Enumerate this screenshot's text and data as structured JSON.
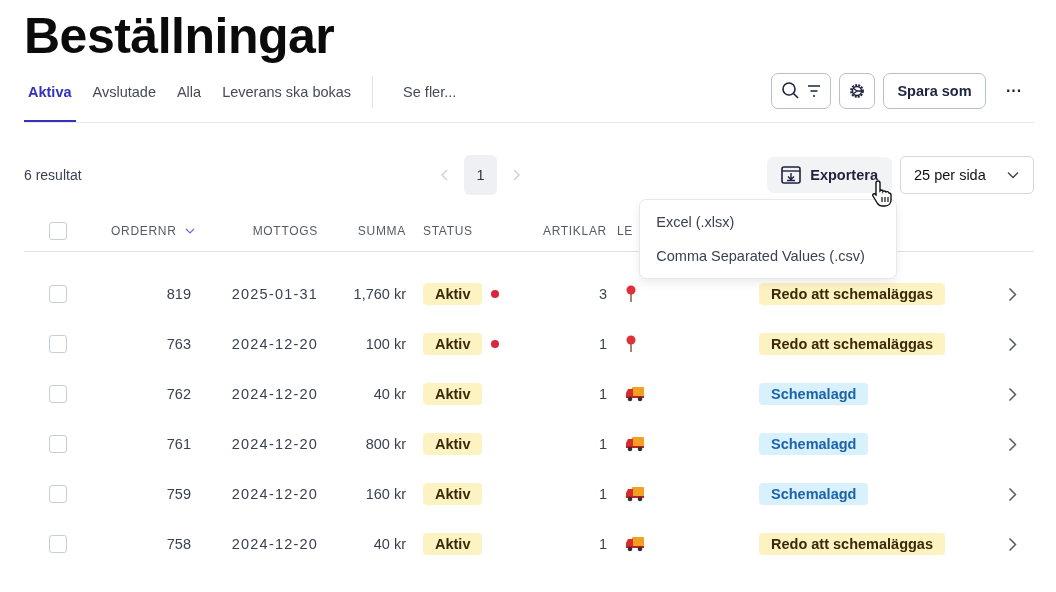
{
  "title": "Beställningar",
  "tabs": [
    {
      "label": "Aktiva",
      "selected": true
    },
    {
      "label": "Avslutade",
      "selected": false
    },
    {
      "label": "Alla",
      "selected": false
    },
    {
      "label": "Leverans ska bokas",
      "selected": false
    }
  ],
  "more_tabs": "Se fler...",
  "toolbar": {
    "save_as": "Spara som",
    "more": "···"
  },
  "results": "6 resultat",
  "pagination": {
    "pages": [
      {
        "label": "1",
        "selected": true
      }
    ]
  },
  "export": {
    "label": "Exportera",
    "menu": [
      "Excel (.xlsx)",
      "Comma Separated Values (.csv)"
    ]
  },
  "per_page": "25 per sida",
  "table": {
    "select_all_checked": false,
    "columns": [
      "ORDERNR",
      "MOTTOGS",
      "SUMMA",
      "STATUS",
      "ARTIKLAR",
      "LE"
    ],
    "rows": [
      {
        "checked": false,
        "order": "819",
        "received": "2025-01-31",
        "sum": "1,760 kr",
        "status": "Aktiv",
        "flagged": true,
        "items": "3",
        "delivery": {
          "kind": "pin"
        },
        "booking": {
          "label": "Redo att schemaläggas",
          "kind": "ready"
        }
      },
      {
        "checked": false,
        "order": "763",
        "received": "2024-12-20",
        "sum": "100 kr",
        "status": "Aktiv",
        "flagged": true,
        "items": "1",
        "delivery": {
          "kind": "pin"
        },
        "booking": {
          "label": "Redo att schemaläggas",
          "kind": "ready"
        }
      },
      {
        "checked": false,
        "order": "762",
        "received": "2024-12-20",
        "sum": "40 kr",
        "status": "Aktiv",
        "flagged": false,
        "items": "1",
        "delivery": {
          "kind": "truck"
        },
        "booking": {
          "label": "Schemalagd",
          "kind": "scheduled"
        }
      },
      {
        "checked": false,
        "order": "761",
        "received": "2024-12-20",
        "sum": "800 kr",
        "status": "Aktiv",
        "flagged": false,
        "items": "1",
        "delivery": {
          "kind": "truck"
        },
        "booking": {
          "label": "Schemalagd",
          "kind": "scheduled"
        }
      },
      {
        "checked": false,
        "order": "759",
        "received": "2024-12-20",
        "sum": "160 kr",
        "status": "Aktiv",
        "flagged": false,
        "items": "1",
        "delivery": {
          "kind": "truck"
        },
        "booking": {
          "label": "Schemalagd",
          "kind": "scheduled"
        }
      },
      {
        "checked": false,
        "order": "758",
        "received": "2024-12-20",
        "sum": "40 kr",
        "status": "Aktiv",
        "flagged": false,
        "items": "1",
        "delivery": {
          "kind": "truck"
        },
        "booking": {
          "label": "Redo att schemaläggas",
          "kind": "ready"
        }
      }
    ]
  }
}
